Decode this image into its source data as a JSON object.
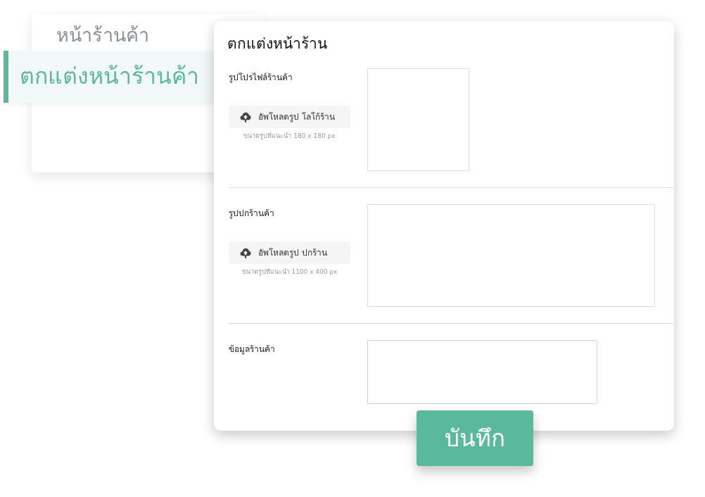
{
  "sidebar": {
    "items": [
      {
        "label": "หน้าร้านค้า",
        "selected": false
      },
      {
        "label": "ตกแต่งหน้าร้านค้า",
        "selected": true
      }
    ]
  },
  "panel": {
    "title": "ตกแต่งหน้าร้าน",
    "sections": [
      {
        "kind": "logo",
        "label": "รูปโปรไฟล์ร้านค้า",
        "upload_button": "อัพโหลดรูป โลโก้ร้าน",
        "hint": "ขนาดรูปที่แนะนำ 180 x 180 px"
      },
      {
        "kind": "cover",
        "label": "รูปปกร้านค้า",
        "upload_button": "อัพโหลดรูป ปกร้าน",
        "hint": "ขนาดรูปที่แนะนำ 1100 x 400 px"
      },
      {
        "kind": "text",
        "label": "ข้อมูลร้านค้า"
      }
    ]
  },
  "save_button": "บันทึก"
}
